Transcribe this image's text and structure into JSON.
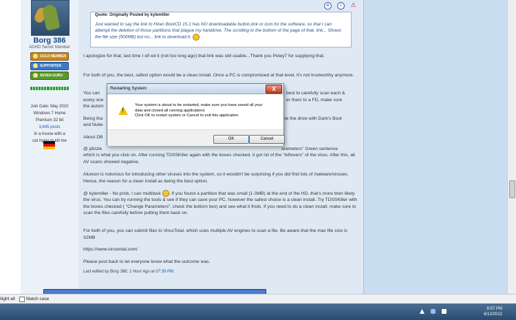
{
  "user": {
    "name": "Borg 386",
    "role": "ADHD Senior Member",
    "badges": [
      "GOLD MEMBER",
      "SUPPORTER",
      "SEVEN GURU"
    ],
    "join_date": "Join Date: May 2010",
    "os_line1": "Windows 7 Home",
    "os_line2": "Premium 32 bit",
    "posts": "3,845 posts",
    "location_line1": "In a house with a",
    "location_line2": "cat trying to kill me"
  },
  "quote": {
    "header": "Quote: Originally Posted by kylemiller",
    "body": "Just wanted to say the link to Hiren BootCD 15.1 has NO downloadable button,link or icon for the software, so that I can attempt the deletion of those partitions that plague my harddrive. The scrolling to the bottom of the page of that, link... Shows the file size (500MB) but no... link to download it."
  },
  "post": {
    "p1": "I apologize for that, last time I d/l ed it (not too long ago) that link was still usable...Thank you Petey7 for supplying that.",
    "p2": "For both of you, the best, safest option would be a clean install. Once a PC is compromised at that level, it's not trustworthy anymore.",
    "p3a": "You can",
    "p3b": "best to carefully scan each &",
    "p3c": "every one",
    "p3d": "er them to a FD, make sure",
    "p3e": "the autom",
    "p4a": "Being tha",
    "p4b": "pe the drive with Dark's Boot",
    "p4c": "and Nuke",
    "p5": "About DB",
    "p6a": "@ jdizzle",
    "p6b": "arameters\" Green sentence",
    "p6c": "which is what you click on. After running TDSSKiller again with the boxes checked, it got rid of the \"leftovers\" of the virus. After this, all AV scans showed negative.",
    "p7": "Alureon is notorious for introducing other viruses into the system, so it wouldn't be surprising if you did find lots of malware/viruses. Hence, the reason for a clean install as being the best option.",
    "p8a": "@ kylemiller - No prob, I can multitask",
    "p8b": ". If you found a partition that was small (1-3MB) at the end of the HD, that's more then likely the virus. You can try running the tools & see if they can save your PC, however the safest choice is a clean install. Try TDSSKiller with the boxes checked ( \"Change Parameters\", check the bottom two) and see what it finds. If you need to do a clean install, make sure to scan the files carefully before putting them back on.",
    "p9": "For both of you, you can submit files to VirusTotal, which uses multiple AV engines to scan a file. Be aware that the max file size is 32MB",
    "link": "https://www.virustotal.com/",
    "p10": "Please post back to let everyone know what the outcome was.",
    "edit_prefix": "Last edited by Borg 386; 1 Hour Ago at",
    "edit_time": "07:39 PM",
    "edit_suffix": "."
  },
  "findbar": {
    "highlight_label": "ilight all",
    "match_case_label": "Match case"
  },
  "dialog": {
    "title": "Restarting System",
    "close_glyph": "X",
    "line1": "Your system is about to be restarted, make sure you have saved all your",
    "line2": "data and closed all running applications",
    "line3": "Click OK to restart system or Cancel to exit this application",
    "ok_label": "OK",
    "cancel_label": "Cancel"
  },
  "taskbar": {
    "time": "8:57 PM",
    "date": "6/12/2012"
  },
  "colors": {
    "forum_bg": "#dfe9f4",
    "link": "#2255aa",
    "quote_text": "#1f4f8c",
    "taskbar": "#2a4c70"
  }
}
